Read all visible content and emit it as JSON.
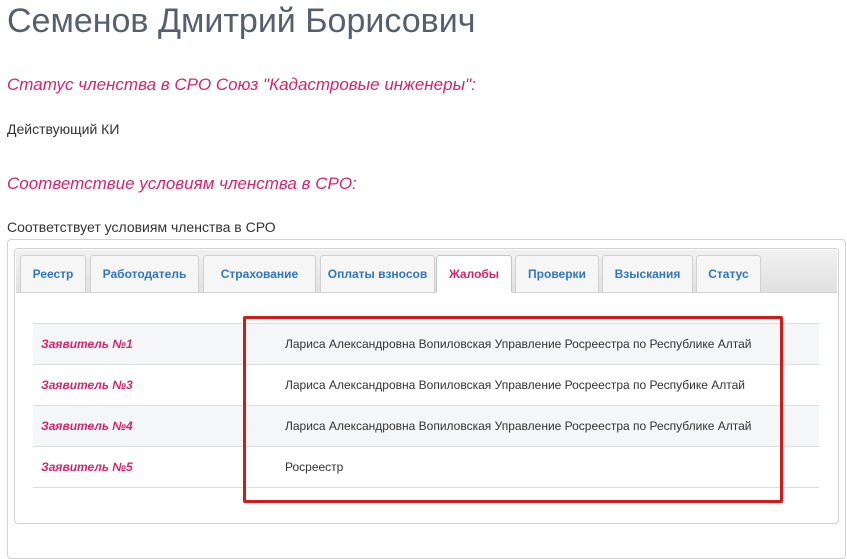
{
  "profile": {
    "name": "Семенов Дмитрий Борисович"
  },
  "membership": {
    "status_heading": "Статус членства в СРО Союз \"Кадастровые инженеры\":",
    "status_value": "Действующий КИ",
    "compliance_heading": "Соответствие условиям членства в СРО:",
    "compliance_value": "Соответствует условиям членства в СРО"
  },
  "tabs": [
    {
      "label": "Реестр"
    },
    {
      "label": "Работодатель"
    },
    {
      "label": "Страхование"
    },
    {
      "label": "Оплаты взносов"
    },
    {
      "label": "Жалобы",
      "active": true
    },
    {
      "label": "Проверки"
    },
    {
      "label": "Взыскания"
    },
    {
      "label": "Статус"
    }
  ],
  "complaints": [
    {
      "applicant": "Заявитель №1",
      "details": "Лариса Александровна Вопиловская Управление Росреестра по Республике Алтай"
    },
    {
      "applicant": "Заявитель №3",
      "details": "Лариса Александровна Вопиловская Управление Росреестра по Респубике Алтай"
    },
    {
      "applicant": "Заявитель №4",
      "details": "Лариса Александровна Вопиловская Управление Росреестра по Республике Алтай"
    },
    {
      "applicant": "Заявитель №5",
      "details": "Росреестр"
    }
  ],
  "colors": {
    "accent_pink": "#d6246e",
    "tab_link_blue": "#2f76c4",
    "highlight_red": "#d01b1b"
  }
}
